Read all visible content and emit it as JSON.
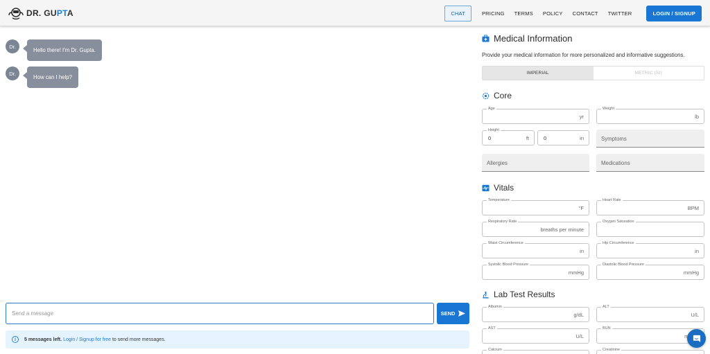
{
  "brand": {
    "prefix": "DR. ",
    "name_a": "GU",
    "name_accent": "PT",
    "name_b": "A",
    "icon": "doctor-logo-icon"
  },
  "nav": {
    "items": [
      "CHAT",
      "PRICING",
      "TERMS",
      "POLICY",
      "CONTACT",
      "TWITTER"
    ],
    "active": "CHAT",
    "login_label": "LOGIN / SIGNUP"
  },
  "chat": {
    "avatar_label": "Dr.",
    "messages": [
      {
        "sender": "Dr.",
        "text": "Hello there! I'm Dr. Gupta."
      },
      {
        "sender": "Dr.",
        "text": "How can I help?"
      }
    ],
    "input_placeholder": "Send a message",
    "input_value": "",
    "send_label": "SEND",
    "info": {
      "count_text": "5 messages left.",
      "link_text": "Login / Signup for free",
      "suffix_text": "to send more messages."
    }
  },
  "medical": {
    "title": "Medical Information",
    "description": "Provide your medical information for more personalized and informative suggestions.",
    "units": {
      "imperial": "IMPERIAL",
      "metric": "METRIC (SI)",
      "selected": "IMPERIAL"
    },
    "core": {
      "title": "Core",
      "age": {
        "label": "Age",
        "unit": "yr",
        "value": ""
      },
      "weight": {
        "label": "Weight",
        "unit": "lb",
        "value": ""
      },
      "height": {
        "label": "Height",
        "ft_value": "0",
        "ft_unit": "ft",
        "in_value": "0",
        "in_unit": "in"
      },
      "symptoms": "Symptoms",
      "allergies": "Allergies",
      "medications": "Medications"
    },
    "vitals": {
      "title": "Vitals",
      "temperature": {
        "label": "Temperature",
        "unit": "°F"
      },
      "heart_rate": {
        "label": "Heart Rate",
        "unit": "BPM"
      },
      "respiratory_rate": {
        "label": "Respiratory Rate",
        "unit": "breaths per minute"
      },
      "oxygen_saturation": {
        "label": "Oxygen Saturation",
        "unit": ""
      },
      "waist": {
        "label": "Waist Circumference",
        "unit": "in"
      },
      "hip": {
        "label": "Hip Circumference",
        "unit": "in"
      },
      "systolic": {
        "label": "Systolic Blood Pressure",
        "unit": "mmHg"
      },
      "diastolic": {
        "label": "Diastolic Blood Pressure",
        "unit": "mmHg"
      }
    },
    "labs": {
      "title": "Lab Test Results",
      "albumin": {
        "label": "Albumin",
        "unit": "g/dL"
      },
      "alt": {
        "label": "ALT",
        "unit": "U/L"
      },
      "ast": {
        "label": "AST",
        "unit": "U/L"
      },
      "bun": {
        "label": "BUN",
        "unit": "mg/dL"
      },
      "calcium": {
        "label": "Calcium",
        "unit": ""
      },
      "creatinine": {
        "label": "Creatinine",
        "unit": ""
      }
    }
  },
  "colors": {
    "primary": "#1976d2",
    "bubble": "#878f9c",
    "info_bg": "#e5f4fc",
    "accent_text": "#1a7fd4"
  }
}
